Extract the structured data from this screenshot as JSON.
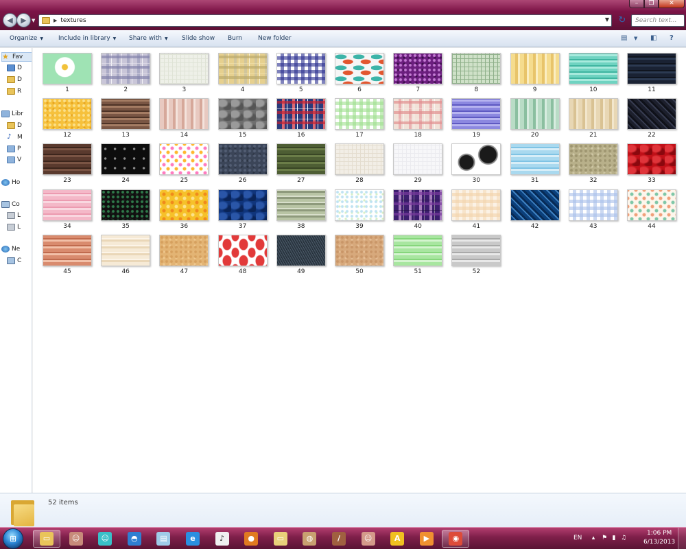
{
  "window": {
    "folder_name": "textures",
    "search_placeholder": "Search text..."
  },
  "toolbar": {
    "organize": "Organize",
    "include_in_library": "Include in library",
    "share_with": "Share with",
    "slide_show": "Slide show",
    "burn": "Burn",
    "new_folder": "New folder"
  },
  "nav": {
    "items": [
      {
        "label": "Fav",
        "icon": "star-icon"
      },
      {
        "label": "D",
        "icon": "desktop-icon"
      },
      {
        "label": "D",
        "icon": "downloads-icon"
      },
      {
        "label": "R",
        "icon": "recent-places-icon"
      },
      {
        "label": "Libr",
        "icon": "library-icon"
      },
      {
        "label": "D",
        "icon": "documents-icon"
      },
      {
        "label": "M",
        "icon": "music-icon"
      },
      {
        "label": "P",
        "icon": "pictures-icon"
      },
      {
        "label": "V",
        "icon": "videos-icon"
      },
      {
        "label": "Ho",
        "icon": "homegroup-icon"
      },
      {
        "label": "Co",
        "icon": "computer-icon"
      },
      {
        "label": "L",
        "icon": "local-disk-icon"
      },
      {
        "label": "L",
        "icon": "local-disk-icon"
      },
      {
        "label": "Ne",
        "icon": "network-icon"
      },
      {
        "label": "C",
        "icon": "network-computer-icon"
      }
    ]
  },
  "files": [
    {
      "name": "1",
      "pattern": "flower",
      "colors": [
        "#9fe3b4",
        "#ffffff",
        "#f2c23a"
      ]
    },
    {
      "name": "2",
      "pattern": "plaid",
      "colors": [
        "#c9c6d8",
        "#7f7fa8",
        "#e9e6ef"
      ]
    },
    {
      "name": "3",
      "pattern": "grid",
      "colors": [
        "#eef0e8",
        "#dfe3d6",
        "#ffffff"
      ]
    },
    {
      "name": "4",
      "pattern": "plaid",
      "colors": [
        "#e6d08f",
        "#b9a86a",
        "#f2e4b4"
      ]
    },
    {
      "name": "5",
      "pattern": "gingham",
      "colors": [
        "#ffffff",
        "#2a2f8f",
        "#8f93c8"
      ]
    },
    {
      "name": "6",
      "pattern": "fish",
      "colors": [
        "#f6f6f6",
        "#3cb4a8",
        "#e2562f"
      ]
    },
    {
      "name": "7",
      "pattern": "dots",
      "colors": [
        "#6b1e7e",
        "#c47cd4",
        "#3d0f4c"
      ]
    },
    {
      "name": "8",
      "pattern": "grid",
      "colors": [
        "#cfe1c8",
        "#8fb08a",
        "#e6f0e2"
      ]
    },
    {
      "name": "9",
      "pattern": "stripes-v",
      "colors": [
        "#f5dc8e",
        "#e8c46a",
        "#fbeec2"
      ]
    },
    {
      "name": "10",
      "pattern": "mosaic",
      "colors": [
        "#6fd3c1",
        "#a8eadd",
        "#3fb5a0"
      ]
    },
    {
      "name": "11",
      "pattern": "stripes-h",
      "colors": [
        "#1a2233",
        "#2c3a52",
        "#10151f"
      ]
    },
    {
      "name": "12",
      "pattern": "dots",
      "colors": [
        "#f6c13c",
        "#fbe08a",
        "#e6a41f"
      ]
    },
    {
      "name": "13",
      "pattern": "mosaic",
      "colors": [
        "#7a5644",
        "#a47c63",
        "#4e3326"
      ]
    },
    {
      "name": "14",
      "pattern": "stripes-v",
      "colors": [
        "#e8c9c0",
        "#d6a89a",
        "#f4e3dc"
      ]
    },
    {
      "name": "15",
      "pattern": "damask",
      "colors": [
        "#6e6e6e",
        "#9a9a9a",
        "#555555"
      ]
    },
    {
      "name": "16",
      "pattern": "plaid",
      "colors": [
        "#2a3a7a",
        "#c8202f",
        "#ffffff"
      ]
    },
    {
      "name": "17",
      "pattern": "gingham",
      "colors": [
        "#ffffff",
        "#9fdf8f",
        "#d7f2cf"
      ]
    },
    {
      "name": "18",
      "pattern": "plaid",
      "colors": [
        "#f1e2d8",
        "#e08c8c",
        "#f7ecea"
      ]
    },
    {
      "name": "19",
      "pattern": "mosaic",
      "colors": [
        "#8c88e0",
        "#b7b4f0",
        "#5e59c2"
      ]
    },
    {
      "name": "20",
      "pattern": "stripes-v",
      "colors": [
        "#b9dcc6",
        "#8bbfa0",
        "#d8ece0"
      ]
    },
    {
      "name": "21",
      "pattern": "stripes-v",
      "colors": [
        "#e8d7b4",
        "#d9c293",
        "#f2e6cc"
      ]
    },
    {
      "name": "22",
      "pattern": "diagonal",
      "colors": [
        "#1c1f2c",
        "#363b4f",
        "#0f1119"
      ]
    },
    {
      "name": "23",
      "pattern": "stripes-h",
      "colors": [
        "#5a3a2e",
        "#7a5444",
        "#3c251c"
      ]
    },
    {
      "name": "24",
      "pattern": "notes",
      "colors": [
        "#0d0d0d",
        "#8a8a8a",
        "#2a2a2a"
      ]
    },
    {
      "name": "25",
      "pattern": "flowers",
      "colors": [
        "#ffffff",
        "#ff7bbf",
        "#ffb72e"
      ]
    },
    {
      "name": "26",
      "pattern": "dots",
      "colors": [
        "#3b4558",
        "#535e74",
        "#2a3241"
      ]
    },
    {
      "name": "27",
      "pattern": "stripes-h",
      "colors": [
        "#4e5e34",
        "#6b7d48",
        "#394625"
      ]
    },
    {
      "name": "28",
      "pattern": "grid",
      "colors": [
        "#f2eee6",
        "#e4ddcf",
        "#faf7f1"
      ]
    },
    {
      "name": "29",
      "pattern": "grid",
      "colors": [
        "#f7f7f9",
        "#ebebef",
        "#ffffff"
      ]
    },
    {
      "name": "30",
      "pattern": "lace",
      "colors": [
        "#ffffff",
        "#1a1a1a",
        "#8a8a8a"
      ]
    },
    {
      "name": "31",
      "pattern": "stripes-h",
      "colors": [
        "#a9d9ef",
        "#d7eef8",
        "#7fc3e4"
      ]
    },
    {
      "name": "32",
      "pattern": "dots",
      "colors": [
        "#b8b08a",
        "#9e9570",
        "#cfc8a6"
      ]
    },
    {
      "name": "33",
      "pattern": "damask",
      "colors": [
        "#c01018",
        "#e0343a",
        "#8a080e"
      ]
    },
    {
      "name": "34",
      "pattern": "stripes-h",
      "colors": [
        "#f4b8c8",
        "#f9d7e0",
        "#ec9ab0"
      ]
    },
    {
      "name": "35",
      "pattern": "dots",
      "colors": [
        "#101010",
        "#2f7a4a",
        "#1d1d1d"
      ]
    },
    {
      "name": "36",
      "pattern": "flowers",
      "colors": [
        "#f6c12a",
        "#f08a1c",
        "#fde28a"
      ]
    },
    {
      "name": "37",
      "pattern": "damask",
      "colors": [
        "#10357c",
        "#2a56a8",
        "#0a2458"
      ]
    },
    {
      "name": "38",
      "pattern": "mosaic",
      "colors": [
        "#b8c4a4",
        "#8e9a7c",
        "#d8dfcb"
      ]
    },
    {
      "name": "39",
      "pattern": "dots",
      "colors": [
        "#ffffff",
        "#bfe3f2",
        "#d8f0c6"
      ]
    },
    {
      "name": "40",
      "pattern": "plaid",
      "colors": [
        "#3c1e6e",
        "#7a3a9e",
        "#1e0f3c"
      ]
    },
    {
      "name": "41",
      "pattern": "gingham",
      "colors": [
        "#fbf2e6",
        "#f2d2a8",
        "#fff9f1"
      ]
    },
    {
      "name": "42",
      "pattern": "diagonal",
      "colors": [
        "#0b3f7a",
        "#3d7fbf",
        "#072a55"
      ]
    },
    {
      "name": "43",
      "pattern": "gingham",
      "colors": [
        "#ffffff",
        "#a9c0ea",
        "#dbe6f8"
      ]
    },
    {
      "name": "44",
      "pattern": "flowers",
      "colors": [
        "#fdf6ec",
        "#7fc7a8",
        "#f0a07a"
      ]
    },
    {
      "name": "45",
      "pattern": "stripes-h",
      "colors": [
        "#d98b6e",
        "#f2c0a8",
        "#c06b4e"
      ]
    },
    {
      "name": "46",
      "pattern": "stripes-h",
      "colors": [
        "#f6ead6",
        "#ead7b8",
        "#fcf4e8"
      ]
    },
    {
      "name": "47",
      "pattern": "dots",
      "colors": [
        "#e3b474",
        "#d6a05e",
        "#efc88f"
      ]
    },
    {
      "name": "48",
      "pattern": "strawberry",
      "colors": [
        "#ffffff",
        "#e23a3a",
        "#4aa04a"
      ]
    },
    {
      "name": "49",
      "pattern": "denim",
      "colors": [
        "#33404c",
        "#4a5866",
        "#232d36"
      ]
    },
    {
      "name": "50",
      "pattern": "dots",
      "colors": [
        "#d7a97c",
        "#c99668",
        "#e6bf97"
      ]
    },
    {
      "name": "51",
      "pattern": "stripes-h",
      "colors": [
        "#a8e6a0",
        "#d4f4cf",
        "#86d67c"
      ]
    },
    {
      "name": "52",
      "pattern": "stripes-h",
      "colors": [
        "#c9c9c9",
        "#e8e8e8",
        "#a9a9a9"
      ]
    }
  ],
  "details": {
    "item_count": "52 items"
  },
  "taskbar": {
    "apps": [
      {
        "icon": "windows-explorer-icon",
        "active": true,
        "color": "#e9c45a"
      },
      {
        "icon": "anime-avatar-icon",
        "active": false,
        "color": "#c78a7a"
      },
      {
        "icon": "vocaloid-icon",
        "active": false,
        "color": "#39c0c8"
      },
      {
        "icon": "shirt-icon",
        "active": false,
        "color": "#2f7fd1"
      },
      {
        "icon": "notepad-icon",
        "active": false,
        "color": "#9fcbe8"
      },
      {
        "icon": "internet-explorer-icon",
        "active": false,
        "color": "#2a8fe0"
      },
      {
        "icon": "music-note-icon",
        "active": false,
        "color": "#f0f0f0"
      },
      {
        "icon": "fox-paw-icon",
        "active": false,
        "color": "#e07a20"
      },
      {
        "icon": "folder-pictures-icon",
        "active": false,
        "color": "#e9d07a"
      },
      {
        "icon": "paint-palette-icon",
        "active": false,
        "color": "#c8a070"
      },
      {
        "icon": "brush-icon",
        "active": false,
        "color": "#a06040"
      },
      {
        "icon": "anime-avatar-icon",
        "active": false,
        "color": "#d49a8a"
      },
      {
        "icon": "app-a-icon",
        "active": false,
        "color": "#f0c020"
      },
      {
        "icon": "media-player-icon",
        "active": false,
        "color": "#f09030"
      },
      {
        "icon": "chrome-icon",
        "active": true,
        "color": "#dd4b39"
      }
    ],
    "language": "EN",
    "time": "1:06 PM",
    "date": "6/13/2013"
  }
}
